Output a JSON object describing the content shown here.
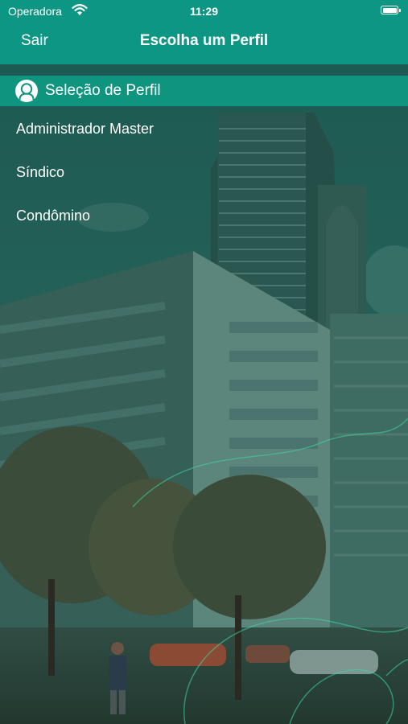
{
  "status_bar": {
    "carrier": "Operadora",
    "time": "11:29",
    "wifi_icon": "wifi-icon",
    "battery_icon": "battery-icon"
  },
  "nav": {
    "back_label": "Sair",
    "title": "Escolha um Perfil",
    "background_color": "#0e9684"
  },
  "section": {
    "icon": "user-avatar-icon",
    "title": "Seleção de Perfil",
    "background_color": "#0f9480"
  },
  "profiles": [
    {
      "label": "Administrador Master"
    },
    {
      "label": "Síndico"
    },
    {
      "label": "Condômino"
    }
  ],
  "background": {
    "description_icon": "building-photo-background",
    "overlay_color": "#0f5a4c"
  }
}
